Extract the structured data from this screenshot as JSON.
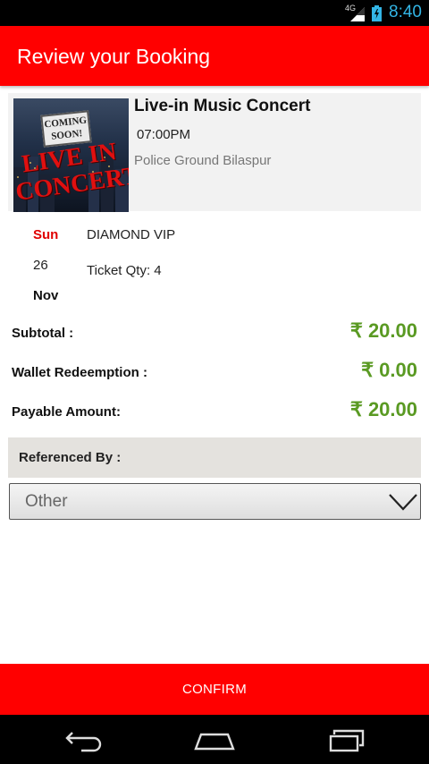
{
  "status_bar": {
    "network_label": "4G",
    "time": "8:40",
    "icons": [
      "signal-icon",
      "battery-icon"
    ]
  },
  "app_bar": {
    "title": "Review your Booking",
    "color": "#ff0000"
  },
  "event": {
    "title": "Live-in Music Concert",
    "time": "07:00PM",
    "venue": "Police Ground Bilaspur",
    "poster": {
      "badge_line1": "COMING",
      "badge_line2": "SOON!",
      "headline_line1": "LIVE IN",
      "headline_line2": "CONCERT"
    }
  },
  "date": {
    "day": "Sun",
    "date": "26",
    "month": "Nov"
  },
  "ticket": {
    "type": "DIAMOND VIP",
    "qty": "Ticket Qty: 4"
  },
  "amounts": {
    "subtotal_label": "Subtotal :",
    "subtotal_value": "₹ 20.00",
    "wallet_label": "Wallet Redeemption :",
    "wallet_value": "₹ 0.00",
    "payable_label": "Payable Amount:",
    "payable_value": "₹ 20.00",
    "value_color": "#5a9a23"
  },
  "referenced_by": {
    "label": "Referenced By :",
    "selected": "Other"
  },
  "confirm_button": {
    "label": "CONFIRM"
  },
  "nav_bar": {
    "icons": [
      "back-icon",
      "home-icon",
      "recent-apps-icon"
    ]
  }
}
